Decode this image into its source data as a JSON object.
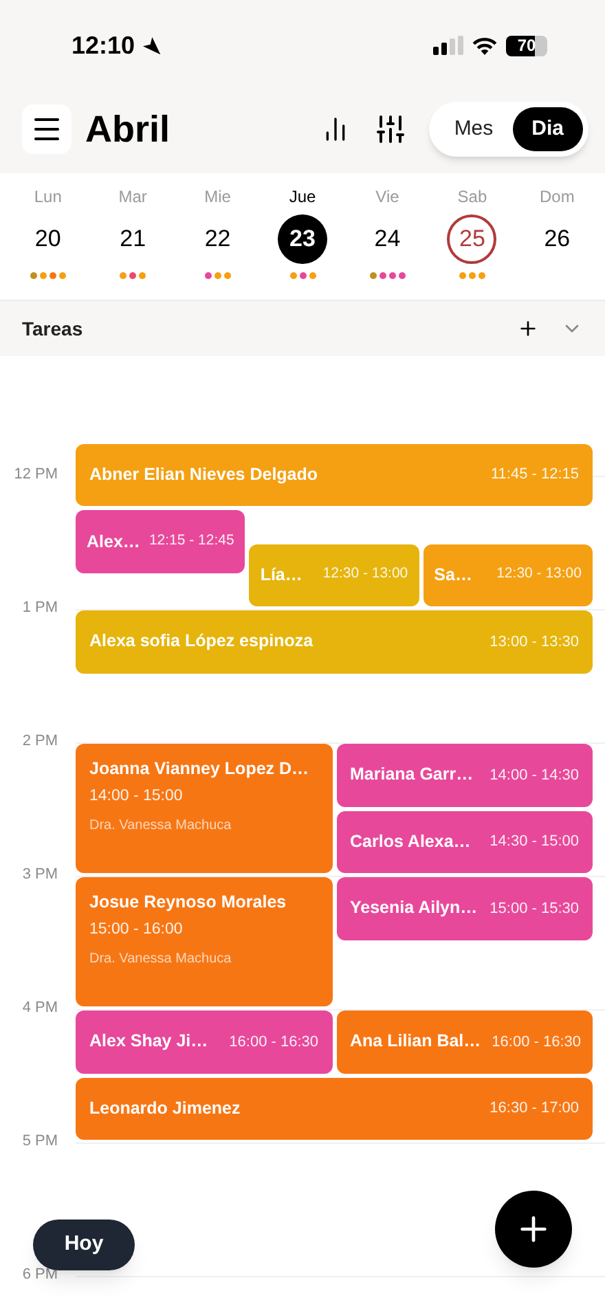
{
  "status_bar": {
    "time": "12:10",
    "battery": "70"
  },
  "header": {
    "title": "Abril",
    "view_toggle": [
      {
        "label": "Mes",
        "selected": false
      },
      {
        "label": "Dia",
        "selected": true
      }
    ]
  },
  "week": [
    {
      "weekday": "Lun",
      "date": "20",
      "selected": false,
      "today": false,
      "dots": [
        {
          "color": "#c0901c"
        },
        {
          "color": "#f5a011"
        },
        {
          "color": "#f77614"
        },
        {
          "color": "#f5a011"
        }
      ]
    },
    {
      "weekday": "Mar",
      "date": "21",
      "selected": false,
      "today": false,
      "dots": [
        {
          "color": "#f5a011"
        },
        {
          "color": "#ec4a6a"
        },
        {
          "color": "#f5a011"
        }
      ]
    },
    {
      "weekday": "Mie",
      "date": "22",
      "selected": false,
      "today": false,
      "dots": [
        {
          "color": "#e8489a"
        },
        {
          "color": "#f5a011"
        },
        {
          "color": "#f5a011"
        }
      ]
    },
    {
      "weekday": "Jue",
      "date": "23",
      "selected": true,
      "today": false,
      "dots": [
        {
          "color": "#f5a011"
        },
        {
          "color": "#e8489a"
        },
        {
          "color": "#f5a011"
        }
      ]
    },
    {
      "weekday": "Vie",
      "date": "24",
      "selected": false,
      "today": false,
      "dots": [
        {
          "color": "#c0901c"
        },
        {
          "color": "#e8489a"
        },
        {
          "color": "#e8489a"
        },
        {
          "color": "#e8489a"
        }
      ]
    },
    {
      "weekday": "Sab",
      "date": "25",
      "selected": false,
      "today": true,
      "dots": [
        {
          "color": "#f5a011"
        },
        {
          "color": "#f5a011"
        },
        {
          "color": "#f5a011"
        }
      ]
    },
    {
      "weekday": "Dom",
      "date": "26",
      "selected": false,
      "today": false
    }
  ],
  "tasks_bar": {
    "label": "Tareas"
  },
  "hours": [
    "12 PM",
    "1 PM",
    "2 PM",
    "3 PM",
    "4 PM",
    "5 PM",
    "6 PM"
  ],
  "event_groups": [
    {
      "columns": [
        [
          {
            "name": "Abner Elian Nieves Delgado",
            "time": "11:45 - 12:15",
            "color": "#f4a012"
          }
        ]
      ]
    },
    {
      "columns": [
        [
          {
            "name": "Alex…",
            "time": "12:15 - 12:45",
            "color": "#e8489a"
          }
        ],
        [
          {
            "name": "Lía…",
            "time": "12:30 - 13:00",
            "color": "#e6b40c"
          }
        ],
        [
          {
            "name": "Sa…",
            "time": "12:30 - 13:00",
            "color": "#f4a012"
          }
        ]
      ]
    },
    {
      "columns": [
        [
          {
            "name": "Alexa sofia López espinoza",
            "time": "13:00 - 13:30",
            "color": "#e6b40c"
          }
        ]
      ]
    },
    {
      "columns": [
        [
          {
            "name": "Joanna Vianney Lopez D…",
            "time": "14:00 - 15:00",
            "doctor": "Dra. Vanessa Machuca",
            "color": "#f77614"
          },
          {
            "name": "Josue Reynoso Morales",
            "time": "15:00 - 16:00",
            "doctor": "Dra. Vanessa Machuca",
            "color": "#f77614"
          },
          {
            "name": "Alex Shay Ji…",
            "time": "16:00 - 16:30",
            "color": "#e8489a"
          }
        ],
        [
          {
            "name": "Mariana Garr…",
            "time": "14:00 - 14:30",
            "color": "#e8489a"
          },
          {
            "name": "Carlos Alexa…",
            "time": "14:30 - 15:00",
            "color": "#e8489a"
          },
          {
            "name": "Yesenia Ailyn…",
            "time": "15:00 - 15:30",
            "color": "#e8489a"
          },
          {
            "name": "Ana Lilian Bal…",
            "time": "16:00 - 16:30",
            "color": "#f77614"
          }
        ]
      ]
    },
    {
      "columns": [
        [
          {
            "name": "Leonardo Jimenez",
            "time": "16:30 - 17:00",
            "color": "#f77614"
          }
        ]
      ]
    }
  ],
  "today_button": {
    "label": "Hoy"
  }
}
